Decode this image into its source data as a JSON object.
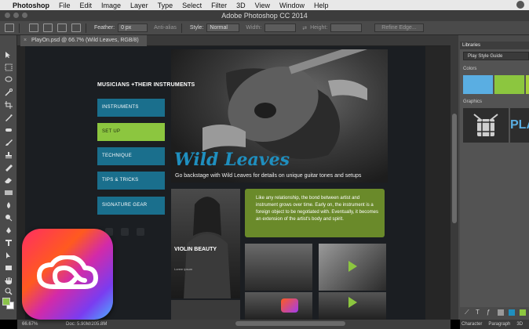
{
  "menubar": {
    "app": "Photoshop",
    "items": [
      "File",
      "Edit",
      "Image",
      "Layer",
      "Type",
      "Select",
      "Filter",
      "3D",
      "View",
      "Window",
      "Help"
    ]
  },
  "window": {
    "title": "Adobe Photoshop CC 2014"
  },
  "options": {
    "feather_label": "Feather:",
    "feather_value": "0 px",
    "antialias_label": "Anti-alias",
    "style_label": "Style:",
    "style_value": "Normal",
    "width_label": "Width:",
    "height_label": "Height:",
    "refine_button": "Refine Edge..."
  },
  "document": {
    "tab_title": "PlayOn.psd @ 66.7% (Wild Leaves, RGB/8)",
    "close": "×"
  },
  "design": {
    "heading": "MUSICIANS +THEIR INSTRUMENTS",
    "nav": [
      "INSTRUMENTS",
      "SET UP",
      "TECHNIQUE",
      "TIPS & TRICKS",
      "SIGNATURE GEAR"
    ],
    "hero_title": "Wild Leaves",
    "hero_subtitle": "Go backstage with Wild Leaves for details on unique guitar tones and setups",
    "quote": "Like any relationship, the bond between artist and instrument grows over time. Early on, the instrument is a foreign object to be negotiated with. Eventually, it becomes an extension of the artist's body and spirit.",
    "violin_label": "VIOLIN BEAUTY",
    "violin_sub": "Lorem ipsum"
  },
  "libraries": {
    "tab": "Libraries",
    "library_name": "Play Style Guide",
    "colors_label": "Colors",
    "graphics_label": "Graphics",
    "graphic_text": "PLA",
    "colors": [
      "#5aaee2",
      "#8cc63f",
      "#a6cf3b"
    ]
  },
  "panel_tabs": [
    "Character",
    "Paragraph",
    "3D"
  ],
  "status": {
    "zoom": "66.67%",
    "doc_info": "Doc: 5.90M/205.8M"
  },
  "colors": {
    "accent_blue": "#1a6f8d",
    "accent_green": "#8cc63f",
    "hero_title": "#1f8fbf"
  }
}
